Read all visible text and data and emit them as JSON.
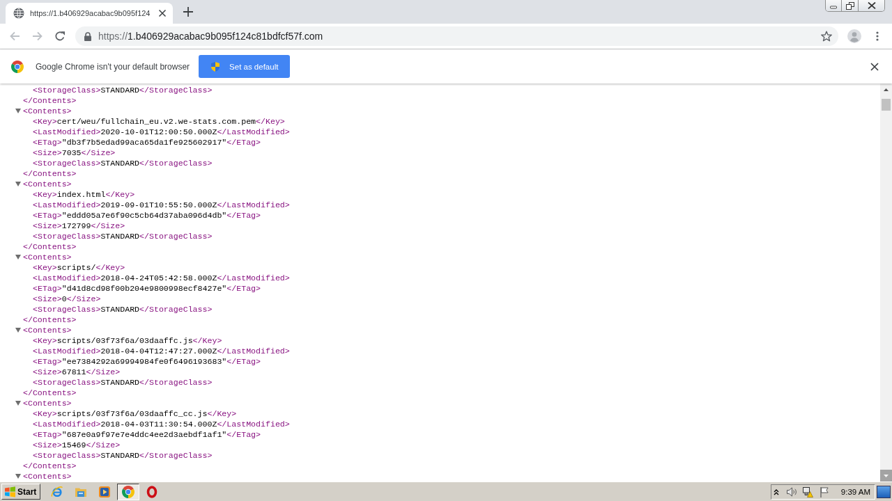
{
  "tabs": [
    {
      "title": "https://1.b406929acabac9b095f124",
      "selected": true
    }
  ],
  "toolbar": {
    "nav_buttons": [
      {
        "kind": "back",
        "disabled": true
      },
      {
        "kind": "forward",
        "disabled": true
      },
      {
        "kind": "reload",
        "disabled": false
      }
    ],
    "address": {
      "scheme": "https://",
      "host": "1.b406929acabac9b095f124c81bdfcf57f.com"
    }
  },
  "infobar": {
    "message": "Google Chrome isn't your default browser",
    "button": "Set as default"
  },
  "xml_view": {
    "nodes": [
      {
        "children": [
          {
            "open": "<StorageClass>",
            "text": "STANDARD",
            "close": "</StorageClass>"
          }
        ],
        "close": "</Contents>"
      },
      {
        "open": "<Contents>",
        "expanded": true,
        "children": [
          {
            "open": "<Key>",
            "text": "cert/weu/fullchain_eu.v2.we-stats.com.pem",
            "close": "</Key>"
          },
          {
            "open": "<LastModified>",
            "text": "2020-10-01T12:00:50.000Z",
            "close": "</LastModified>"
          },
          {
            "open": "<ETag>",
            "text": "\"db3f7b5edad99aca65da1fe925602917\"",
            "close": "</ETag>"
          },
          {
            "open": "<Size>",
            "text": "7035",
            "close": "</Size>"
          },
          {
            "open": "<StorageClass>",
            "text": "STANDARD",
            "close": "</StorageClass>"
          }
        ],
        "close": "</Contents>"
      },
      {
        "open": "<Contents>",
        "expanded": true,
        "children": [
          {
            "open": "<Key>",
            "text": "index.html",
            "close": "</Key>"
          },
          {
            "open": "<LastModified>",
            "text": "2019-09-01T10:55:50.000Z",
            "close": "</LastModified>"
          },
          {
            "open": "<ETag>",
            "text": "\"eddd05a7e6f90c5cb64d37aba096d4db\"",
            "close": "</ETag>"
          },
          {
            "open": "<Size>",
            "text": "172799",
            "close": "</Size>"
          },
          {
            "open": "<StorageClass>",
            "text": "STANDARD",
            "close": "</StorageClass>"
          }
        ],
        "close": "</Contents>"
      },
      {
        "open": "<Contents>",
        "expanded": true,
        "children": [
          {
            "open": "<Key>",
            "text": "scripts/",
            "close": "</Key>"
          },
          {
            "open": "<LastModified>",
            "text": "2018-04-24T05:42:58.000Z",
            "close": "</LastModified>"
          },
          {
            "open": "<ETag>",
            "text": "\"d41d8cd98f00b204e9800998ecf8427e\"",
            "close": "</ETag>"
          },
          {
            "open": "<Size>",
            "text": "0",
            "close": "</Size>"
          },
          {
            "open": "<StorageClass>",
            "text": "STANDARD",
            "close": "</StorageClass>"
          }
        ],
        "close": "</Contents>"
      },
      {
        "open": "<Contents>",
        "expanded": true,
        "children": [
          {
            "open": "<Key>",
            "text": "scripts/03f73f6a/03daaffc.js",
            "close": "</Key>"
          },
          {
            "open": "<LastModified>",
            "text": "2018-04-04T12:47:27.000Z",
            "close": "</LastModified>"
          },
          {
            "open": "<ETag>",
            "text": "\"ee7384292a69994984fe0f6496193683\"",
            "close": "</ETag>"
          },
          {
            "open": "<Size>",
            "text": "67811",
            "close": "</Size>"
          },
          {
            "open": "<StorageClass>",
            "text": "STANDARD",
            "close": "</StorageClass>"
          }
        ],
        "close": "</Contents>"
      },
      {
        "open": "<Contents>",
        "expanded": true,
        "children": [
          {
            "open": "<Key>",
            "text": "scripts/03f73f6a/03daaffc_cc.js",
            "close": "</Key>"
          },
          {
            "open": "<LastModified>",
            "text": "2018-04-03T11:30:54.000Z",
            "close": "</LastModified>"
          },
          {
            "open": "<ETag>",
            "text": "\"687e0a9f97e7e4ddc4ee2d3aebdf1af1\"",
            "close": "</ETag>"
          },
          {
            "open": "<Size>",
            "text": "15469",
            "close": "</Size>"
          },
          {
            "open": "<StorageClass>",
            "text": "STANDARD",
            "close": "</StorageClass>"
          }
        ],
        "close": "</Contents>"
      },
      {
        "open": "<Contents>",
        "expanded": true
      }
    ]
  },
  "taskbar": {
    "start": "Start",
    "apps": [
      {
        "kind": "ie",
        "selected": false
      },
      {
        "kind": "folder",
        "selected": false
      },
      {
        "kind": "player",
        "selected": false
      },
      {
        "kind": "chrome",
        "selected": true
      },
      {
        "kind": "opera",
        "selected": false
      }
    ],
    "clock": "9:39 AM"
  }
}
